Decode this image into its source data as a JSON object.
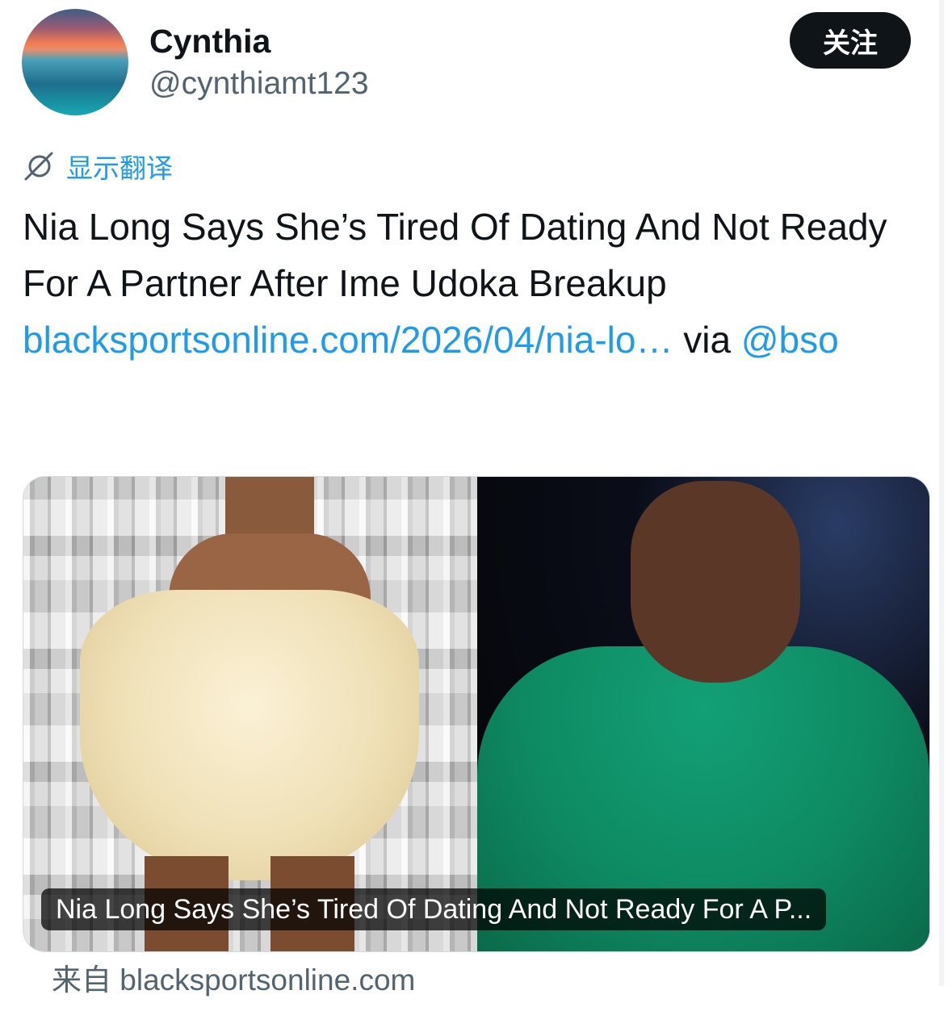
{
  "author": {
    "display_name": "Cynthia",
    "handle": "@cynthiamt123"
  },
  "follow_button": {
    "label": "关注"
  },
  "translate": {
    "label": "显示翻译",
    "icon": "translate-icon"
  },
  "tweet": {
    "text": "Nia Long Says She’s Tired Of Dating And Not Ready For A Partner After Ime Udoka Breakup",
    "link": "blacksportsonline.com/2026/04/nia-lo…",
    "via": "via",
    "mention": "@bso"
  },
  "card": {
    "caption": "Nia Long Says She’s Tired Of Dating And Not Ready For A P...",
    "source_prefix": "来自",
    "source_domain": "blacksportsonline.com"
  },
  "colors": {
    "accent": "#1d9bf0",
    "text": "#0f1419",
    "muted": "#536471",
    "button_bg": "#0f1419"
  }
}
